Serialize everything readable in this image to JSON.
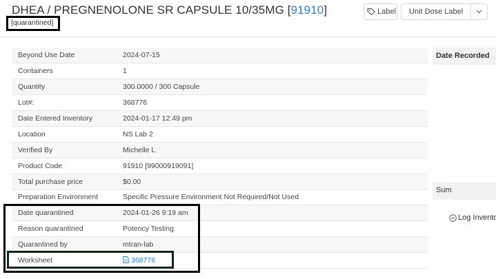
{
  "header": {
    "title_prefix": "DHEA / PREGNENOLONE SR CAPSULE 10/35MG [",
    "title_link": "91910",
    "title_suffix": "]",
    "status": "[quarantined]",
    "label_button": "Label",
    "unit_dose_button": "Unit Dose Label"
  },
  "details": [
    {
      "label": "Beyond Use Date",
      "value": "2024-07-15"
    },
    {
      "label": "Containers",
      "value": "1"
    },
    {
      "label": "Quantity",
      "value": "300.0000 / 300 Capsule"
    },
    {
      "label": "Lot#:",
      "value": "368776"
    },
    {
      "label": "Date Entered Inventory",
      "value": "2024-01-17 12:49 pm"
    },
    {
      "label": "Location",
      "value": "NS Lab 2"
    },
    {
      "label": "Verified By",
      "value": "Michelle L"
    },
    {
      "label": "Product Code",
      "value": "91910 [99000919091]"
    },
    {
      "label": "Total purchase price",
      "value": "$0.00"
    },
    {
      "label": "Preparation Environment",
      "value": "Specific Pressure Environment Not Required/Not Used"
    },
    {
      "label": "Date quarantined",
      "value": "2024-01-26 9:19 am"
    },
    {
      "label": "Reason quarantined",
      "value": "Potency Testing"
    },
    {
      "label": "Quarantined by",
      "value": "mtran-lab"
    },
    {
      "label": "Worksheet",
      "value": "368776"
    }
  ],
  "side": {
    "date_recorded_header": "Date Recorded",
    "sum_label": "Sum",
    "log_inventory_label": "Log Invento"
  },
  "icons": {
    "label_button_icon": "tag-icon",
    "unit_dose_caret": "chevron-down-icon",
    "worksheet_icon": "document-icon",
    "log_icon": "minus-circle-icon"
  },
  "colors": {
    "link": "#2a7fd4",
    "stripe": "#f7f7f7",
    "highlight_border": "#000000"
  }
}
